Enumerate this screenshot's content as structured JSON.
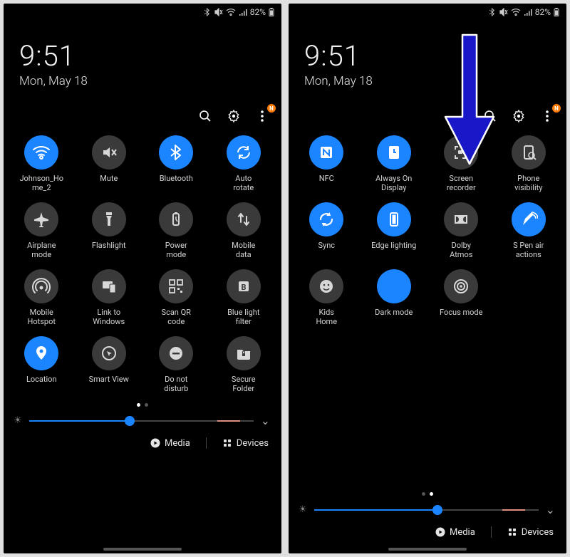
{
  "status": {
    "battery_pct": "82%"
  },
  "clock": {
    "time": "9:51",
    "date": "Mon, May 18"
  },
  "toolbar": {
    "badge": "N"
  },
  "page1_tiles": [
    {
      "label": "Johnson_Ho\nme_2",
      "icon": "wifi",
      "on": true
    },
    {
      "label": "Mute",
      "icon": "mute",
      "on": false
    },
    {
      "label": "Bluetooth",
      "icon": "bluetooth",
      "on": true
    },
    {
      "label": "Auto\nrotate",
      "icon": "autorotate",
      "on": true
    },
    {
      "label": "Airplane\nmode",
      "icon": "airplane",
      "on": false
    },
    {
      "label": "Flashlight",
      "icon": "flashlight",
      "on": false
    },
    {
      "label": "Power\nmode",
      "icon": "power",
      "on": false
    },
    {
      "label": "Mobile\ndata",
      "icon": "mobiledata",
      "on": false
    },
    {
      "label": "Mobile\nHotspot",
      "icon": "hotspot",
      "on": false
    },
    {
      "label": "Link to\nWindows",
      "icon": "linkwin",
      "on": false
    },
    {
      "label": "Scan QR\ncode",
      "icon": "qr",
      "on": false
    },
    {
      "label": "Blue light\nfilter",
      "icon": "bluelight",
      "on": false
    },
    {
      "label": "Location",
      "icon": "location",
      "on": true
    },
    {
      "label": "Smart View",
      "icon": "smartview",
      "on": false
    },
    {
      "label": "Do not\ndisturb",
      "icon": "dnd",
      "on": false
    },
    {
      "label": "Secure\nFolder",
      "icon": "securefolder",
      "on": false
    }
  ],
  "page2_tiles": [
    {
      "label": "NFC",
      "icon": "nfc",
      "on": true
    },
    {
      "label": "Always On\nDisplay",
      "icon": "aod",
      "on": true
    },
    {
      "label": "Screen\nrecorder",
      "icon": "screenrec",
      "on": false
    },
    {
      "label": "Phone\nvisibility",
      "icon": "visibility",
      "on": false
    },
    {
      "label": "Sync",
      "icon": "sync",
      "on": true
    },
    {
      "label": "Edge lighting",
      "icon": "edgelight",
      "on": true
    },
    {
      "label": "Dolby\nAtmos",
      "icon": "dolby",
      "on": false
    },
    {
      "label": "S Pen air\nactions",
      "icon": "spen",
      "on": true
    },
    {
      "label": "Kids\nHome",
      "icon": "kids",
      "on": false
    },
    {
      "label": "Dark mode",
      "icon": "darkmode",
      "on": true
    },
    {
      "label": "Focus mode",
      "icon": "focus",
      "on": false
    }
  ],
  "dots": {
    "page1_active": 0,
    "page2_active": 1
  },
  "brightness": {
    "percent_page1": 45,
    "percent_page2": 55
  },
  "footer": {
    "media": "Media",
    "devices": "Devices"
  },
  "colors": {
    "accent": "#1b84ff",
    "toggle_off": "#3a3a3a",
    "badge": "#ff7b00",
    "arrow": "#1818c9"
  }
}
